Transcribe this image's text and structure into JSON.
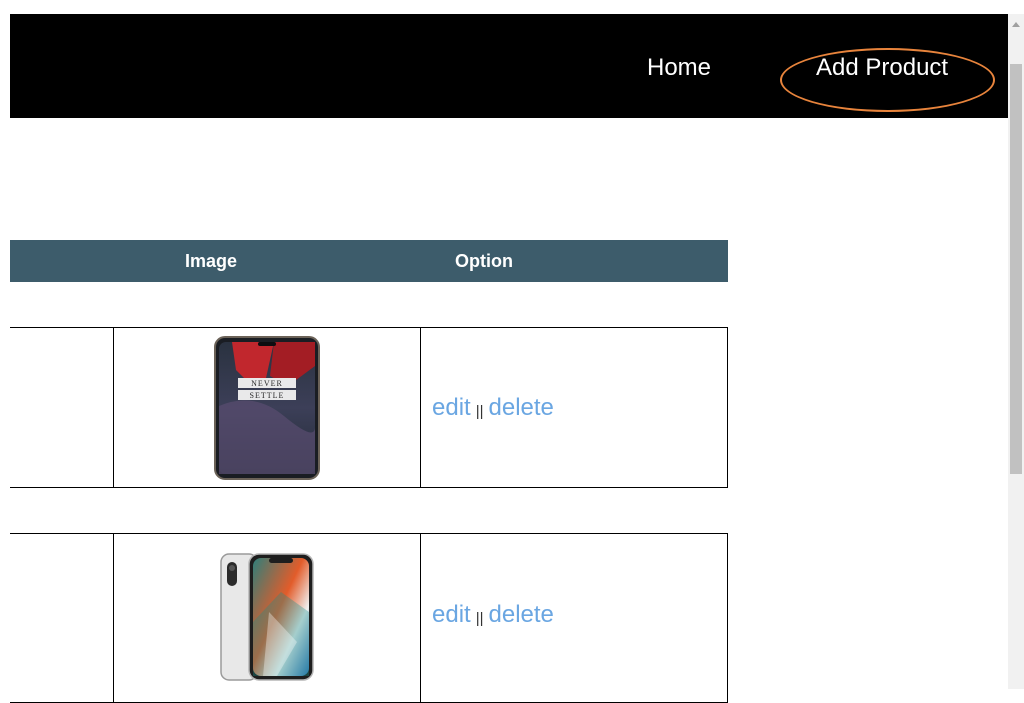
{
  "nav": {
    "home_label": "Home",
    "add_product_label": "Add Product",
    "highlight_color": "#e8843c",
    "background": "#000000"
  },
  "table": {
    "header_color": "#3d5c6b",
    "columns": [
      "Image",
      "Option"
    ],
    "rows": [
      {
        "image_icon": "oneplus-phone-image",
        "image_text": [
          "NEVER",
          "SETTLE"
        ],
        "edit_label": "edit",
        "separator": "||",
        "delete_label": "delete"
      },
      {
        "image_icon": "iphone-x-image",
        "edit_label": "edit",
        "separator": "||",
        "delete_label": "delete"
      }
    ]
  },
  "colors": {
    "link": "#6aa6e2"
  }
}
